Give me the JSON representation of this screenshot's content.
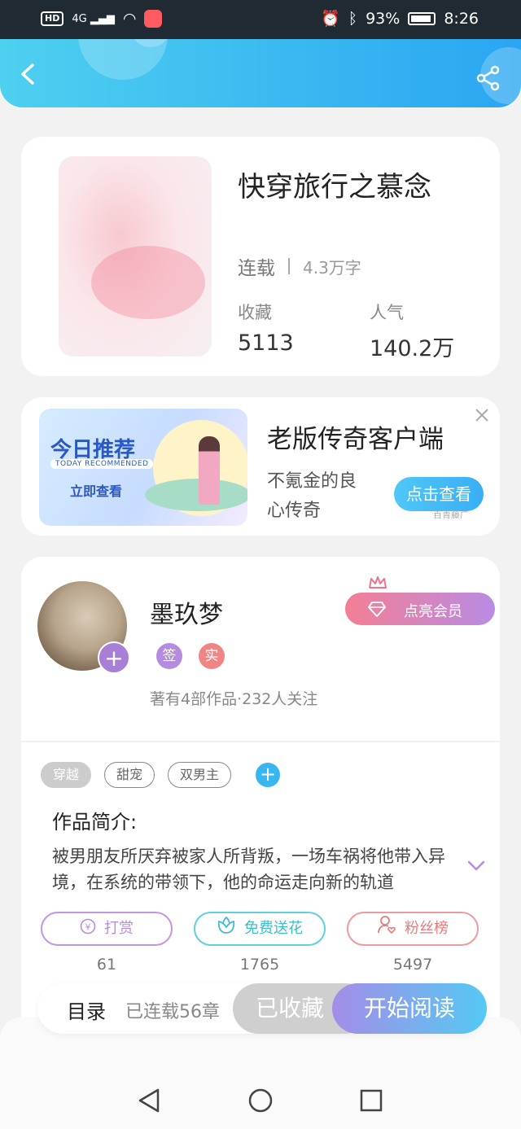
{
  "status_bar": {
    "network": "4G",
    "battery": "93%",
    "time": "8:26"
  },
  "book": {
    "title": "快穿旅行之慕念",
    "status": "连载",
    "words": "4.3万字",
    "stats": [
      {
        "label": "收藏",
        "value": "5113"
      },
      {
        "label": "人气",
        "value": "140.2万"
      }
    ]
  },
  "ad": {
    "banner_title": "今日推荐",
    "banner_subtitle": "TODAY RECOMMENDED",
    "banner_action": "立即查看",
    "title": "老版传奇客户端",
    "description": "不氪金的良心传奇",
    "cta": "点击查看",
    "source": "百青藤广"
  },
  "author": {
    "name": "墨玖梦",
    "badges": [
      "签",
      "实"
    ],
    "stats": "著有4部作品·232人关注",
    "vip_button": "点亮会员"
  },
  "tags": [
    {
      "label": "穿越",
      "active": true
    },
    {
      "label": "甜宠",
      "active": false
    },
    {
      "label": "双男主",
      "active": false
    }
  ],
  "intro": {
    "title": "作品简介:",
    "text": "被男朋友所厌弃被家人所背叛，一场车祸将他带入异境，在系统的带领下，他的命运走向新的轨道"
  },
  "actions": [
    {
      "label": "打赏",
      "count": "61",
      "icon": "yuan-icon"
    },
    {
      "label": "免费送花",
      "count": "1765",
      "icon": "flower-icon"
    },
    {
      "label": "粉丝榜",
      "count": "5497",
      "icon": "fan-icon"
    }
  ],
  "bottom_bar": {
    "toc": "目录",
    "chapters": "已连载56章",
    "saved": "已收藏",
    "read": "开始阅读"
  },
  "colors": {
    "header_start": "#4ed0f0",
    "header_end": "#2aa6f2",
    "accent_purple": "#b58be0",
    "accent_cyan": "#3fbccc",
    "accent_red": "#e77a7a"
  }
}
